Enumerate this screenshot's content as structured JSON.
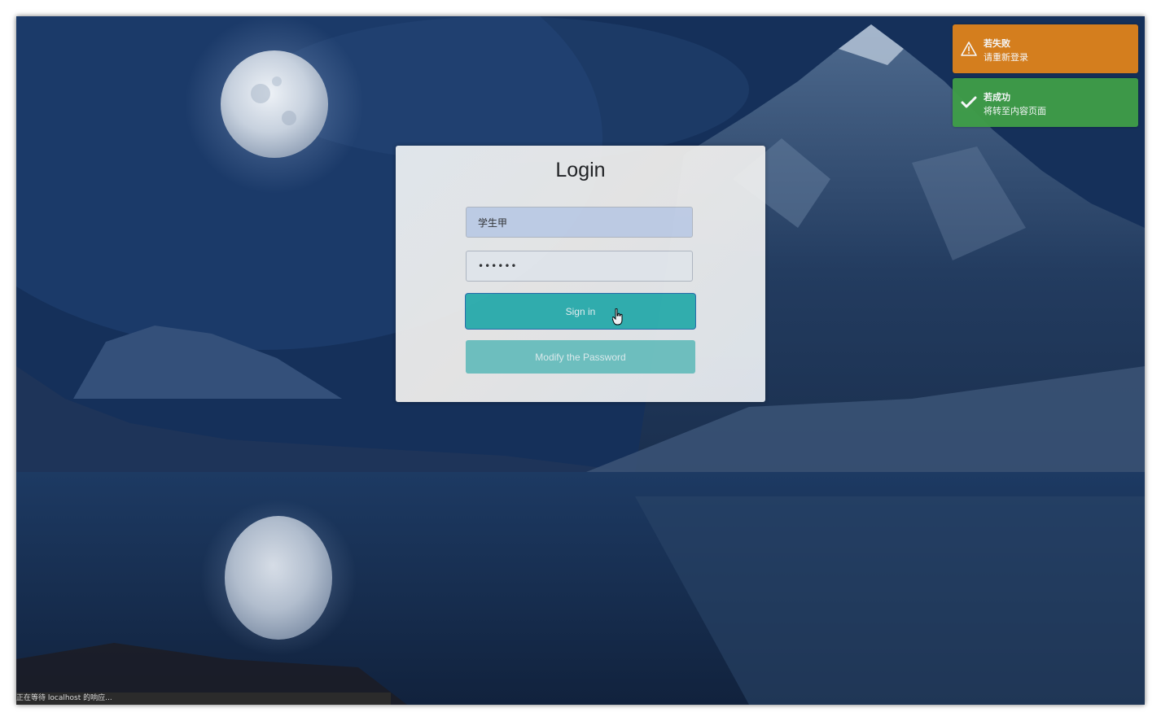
{
  "login": {
    "title": "Login",
    "username_value": "学生甲",
    "password_value": "••••••",
    "signin_label": "Sign in",
    "modify_label": "Modify the Password"
  },
  "notifications": [
    {
      "type": "warning",
      "icon": "warning-triangle-icon",
      "title": "若失败",
      "text": "请重新登录",
      "color": "#dc821c"
    },
    {
      "type": "success",
      "icon": "check-icon",
      "title": "若成功",
      "text": "将转至内容页面",
      "color": "#3f9d48"
    }
  ],
  "status_bar": {
    "text": "正在等待 localhost 的响应..."
  },
  "colors": {
    "accent": "#33b6b4",
    "accent_light": "#74c9c6",
    "background": "#1a3a66"
  }
}
